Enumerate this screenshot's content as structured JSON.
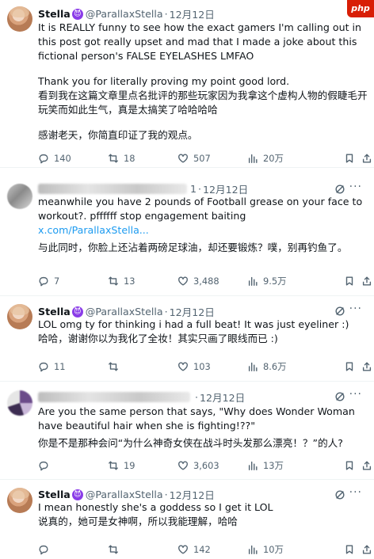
{
  "watermark": "php",
  "tweets": [
    {
      "name": "Stella",
      "badge_icon": "purple-devil-emoji",
      "handle": "@ParallaxStella",
      "date": "12月12日",
      "lines": [
        "It is REALLY funny to see how the exact gamers I'm calling out in this post got really upset and mad that I made a joke about this fictional person's FALSE EYELASHES LMFAO",
        "Thank you for literally proving my point good lord.",
        "看到我在这篇文章里点名批评的那些玩家因为我拿这个虚构人物的假睫毛开玩笑而如此生气，真是太搞笑了哈哈哈哈",
        "感谢老天，你简直印证了我的观点。"
      ],
      "stats": {
        "replies": "140",
        "retweets": "18",
        "likes": "507",
        "views": "20万"
      }
    },
    {
      "name": "",
      "handle": "",
      "handle_tail": "1",
      "date": "12月12日",
      "lines": [
        "meanwhile you have 2 pounds of Football grease on your face to workout?. pffffff  stop engagement baiting",
        "x.com/ParallaxStella...",
        "与此同时，你脸上还沾着两磅足球油，却还要锻炼？噗，别再钓鱼了。"
      ],
      "stats": {
        "replies": "7",
        "retweets": "13",
        "likes": "3,488",
        "views": "9.5万"
      }
    },
    {
      "name": "Stella",
      "badge_icon": "purple-devil-emoji",
      "handle": "@ParallaxStella",
      "date": "12月12日",
      "lines": [
        "LOL omg ty for thinking i had a full beat! It was just eyeliner :)",
        "哈哈，谢谢你以为我化了全妆！其实只画了眼线而已 :)"
      ],
      "stats": {
        "replies": "11",
        "retweets": "",
        "likes": "103",
        "views": "8.6万"
      }
    },
    {
      "name": "",
      "handle": "",
      "date": "12月12日",
      "lines": [
        "Are you the same person that says, \"Why does Wonder Woman have beautiful hair when she is fighting!??\"",
        "你是不是那种会问“为什么神奇女侠在战斗时头发那么漂亮！？”的人?"
      ],
      "stats": {
        "replies": "",
        "retweets": "19",
        "likes": "3,603",
        "views": "13万"
      }
    },
    {
      "name": "Stella",
      "badge_icon": "purple-devil-emoji",
      "handle": "@ParallaxStella",
      "date": "12月12日",
      "lines": [
        "I mean honestly she's a goddess so I get it LOL",
        "说真的，她可是女神啊，所以我能理解，哈哈"
      ],
      "stats": {
        "replies": "",
        "retweets": "",
        "likes": "142",
        "views": "10万"
      }
    }
  ],
  "ui": {
    "dot": "·",
    "more": "···",
    "badge_glyph": "😈",
    "accent": "#1d9bf0",
    "text_secondary": "#536471"
  }
}
